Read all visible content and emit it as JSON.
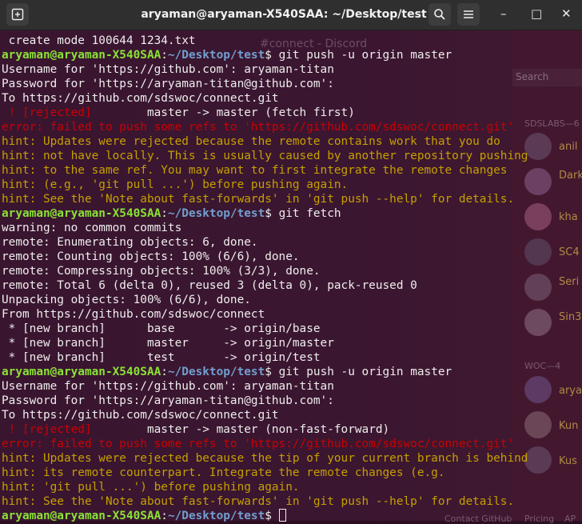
{
  "window": {
    "title": "aryaman@aryaman-X540SAA: ~/Desktop/test",
    "new_tab_icon": "new-terminal-tab-icon",
    "search_icon": "search-icon",
    "menu_icon": "hamburger-menu-icon",
    "minimize": "–",
    "maximize": "□",
    "close": "✕"
  },
  "background": {
    "channel_title": "#connect - Discord",
    "search_placeholder": "Search",
    "group1": "SDSLABS—6",
    "group2": "WOC—4",
    "members": [
      "anil",
      "Dark",
      "kha",
      "SC4",
      "Seri",
      "Sin3",
      "arya",
      "Kun",
      "Kus"
    ],
    "bottom_links": [
      "Contact GitHub",
      "Pricing",
      "AP"
    ]
  },
  "prompt": {
    "user": "aryaman@aryaman-X540SAA",
    "path": "~/Desktop/test"
  },
  "lines": [
    {
      "type": "plain",
      "text": " create mode 100644 1234.txt"
    },
    {
      "type": "prompt",
      "cmd": " git push -u origin master"
    },
    {
      "type": "plain",
      "text": "Username for 'https://github.com': aryaman-titan"
    },
    {
      "type": "plain",
      "text": "Password for 'https://aryaman-titan@github.com':"
    },
    {
      "type": "plain",
      "text": "To https://github.com/sdswoc/connect.git"
    },
    {
      "type": "rejected",
      "tag": " ! [rejected]",
      "text": "        master -> master (fetch first)"
    },
    {
      "type": "red",
      "text": "error: failed to push some refs to 'https://github.com/sdswoc/connect.git'"
    },
    {
      "type": "yellow",
      "text": "hint: Updates were rejected because the remote contains work that you do"
    },
    {
      "type": "yellow",
      "text": "hint: not have locally. This is usually caused by another repository pushing"
    },
    {
      "type": "yellow",
      "text": "hint: to the same ref. You may want to first integrate the remote changes"
    },
    {
      "type": "yellow",
      "text": "hint: (e.g., 'git pull ...') before pushing again."
    },
    {
      "type": "yellow",
      "text": "hint: See the 'Note about fast-forwards' in 'git push --help' for details."
    },
    {
      "type": "prompt",
      "cmd": " git fetch"
    },
    {
      "type": "plain",
      "text": "warning: no common commits"
    },
    {
      "type": "plain",
      "text": "remote: Enumerating objects: 6, done."
    },
    {
      "type": "plain",
      "text": "remote: Counting objects: 100% (6/6), done."
    },
    {
      "type": "plain",
      "text": "remote: Compressing objects: 100% (3/3), done."
    },
    {
      "type": "plain",
      "text": "remote: Total 6 (delta 0), reused 3 (delta 0), pack-reused 0"
    },
    {
      "type": "plain",
      "text": "Unpacking objects: 100% (6/6), done."
    },
    {
      "type": "plain",
      "text": "From https://github.com/sdswoc/connect"
    },
    {
      "type": "plain",
      "text": " * [new branch]      base       -> origin/base"
    },
    {
      "type": "plain",
      "text": " * [new branch]      master     -> origin/master"
    },
    {
      "type": "plain",
      "text": " * [new branch]      test       -> origin/test"
    },
    {
      "type": "prompt",
      "cmd": " git push -u origin master"
    },
    {
      "type": "plain",
      "text": "Username for 'https://github.com': aryaman-titan"
    },
    {
      "type": "plain",
      "text": "Password for 'https://aryaman-titan@github.com':"
    },
    {
      "type": "plain",
      "text": "To https://github.com/sdswoc/connect.git"
    },
    {
      "type": "rejected",
      "tag": " ! [rejected]",
      "text": "        master -> master (non-fast-forward)"
    },
    {
      "type": "red",
      "text": "error: failed to push some refs to 'https://github.com/sdswoc/connect.git'"
    },
    {
      "type": "yellow",
      "text": "hint: Updates were rejected because the tip of your current branch is behind"
    },
    {
      "type": "yellow",
      "text": "hint: its remote counterpart. Integrate the remote changes (e.g."
    },
    {
      "type": "yellow",
      "text": "hint: 'git pull ...') before pushing again."
    },
    {
      "type": "yellow",
      "text": "hint: See the 'Note about fast-forwards' in 'git push --help' for details."
    },
    {
      "type": "prompt-cursor",
      "cmd": " "
    }
  ]
}
